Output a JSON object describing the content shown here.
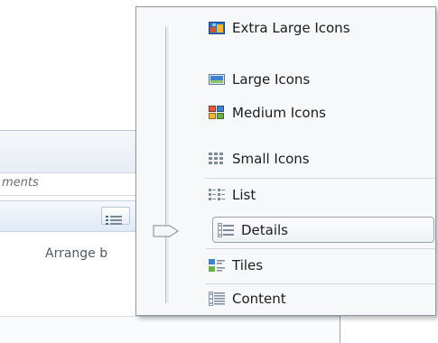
{
  "background": {
    "search_text": "ments",
    "arrange_text": "Arrange b"
  },
  "menu": {
    "items": [
      {
        "label": "Extra Large Icons",
        "icon": "extra-large-icons-icon"
      },
      {
        "label": "Large Icons",
        "icon": "large-icons-icon"
      },
      {
        "label": "Medium Icons",
        "icon": "medium-icons-icon"
      },
      {
        "label": "Small Icons",
        "icon": "small-icons-icon"
      },
      {
        "label": "List",
        "icon": "list-icon"
      },
      {
        "label": "Details",
        "icon": "details-icon",
        "selected": true
      },
      {
        "label": "Tiles",
        "icon": "tiles-icon"
      },
      {
        "label": "Content",
        "icon": "content-icon"
      }
    ]
  },
  "colors": {
    "accent_blue": "#2d7bd3",
    "menu_bg": "#f7f8fa",
    "border": "#8d959e"
  }
}
